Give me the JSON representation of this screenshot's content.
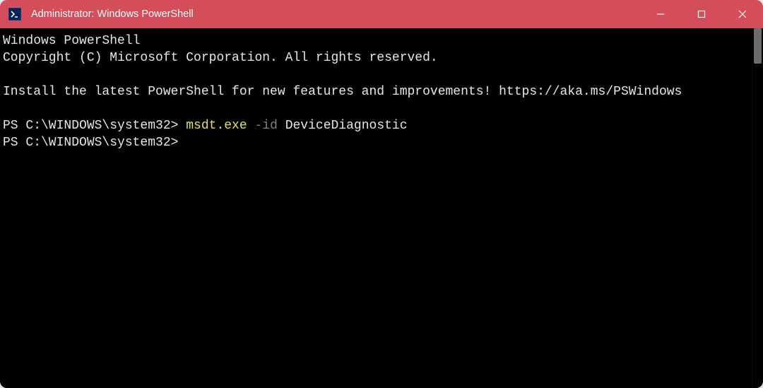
{
  "titlebar": {
    "title": "Administrator: Windows PowerShell"
  },
  "terminal": {
    "line1": "Windows PowerShell",
    "line2": "Copyright (C) Microsoft Corporation. All rights reserved.",
    "line3": "Install the latest PowerShell for new features and improvements! https://aka.ms/PSWindows",
    "prompt1": "PS C:\\WINDOWS\\system32> ",
    "cmd_exe": "msdt.exe",
    "cmd_flag": " -id",
    "cmd_arg": " DeviceDiagnostic",
    "prompt2": "PS C:\\WINDOWS\\system32>"
  }
}
